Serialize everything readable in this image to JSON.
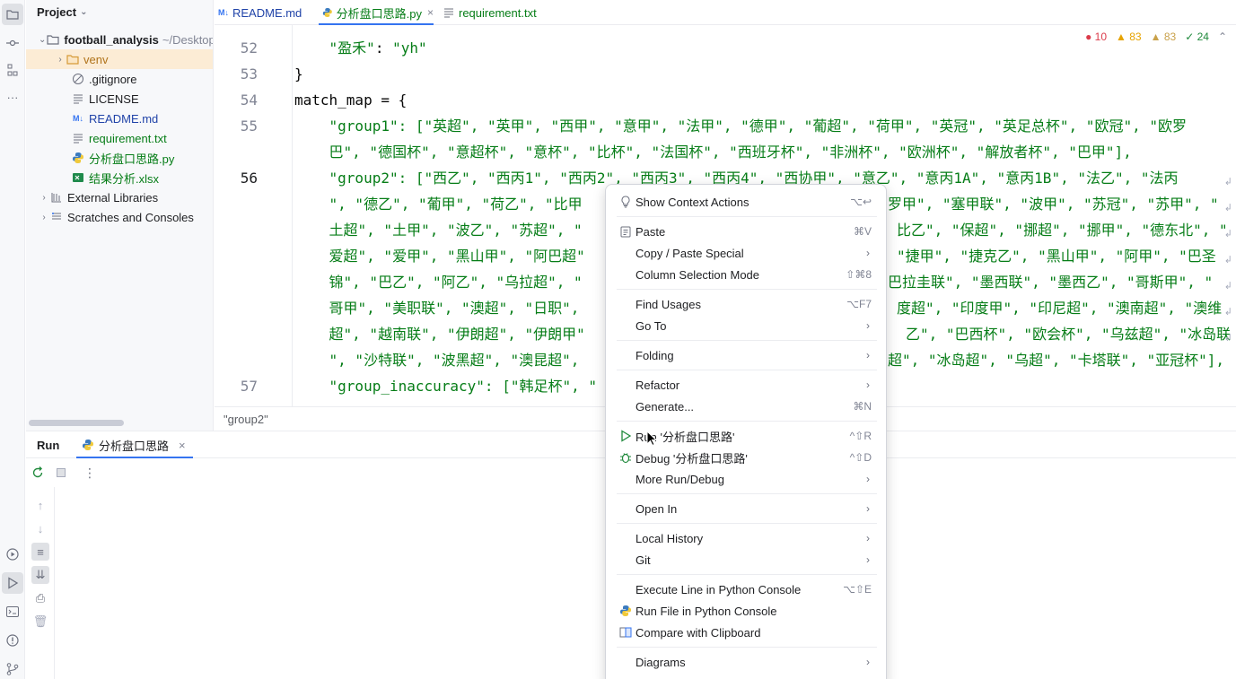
{
  "project": {
    "title": "Project",
    "tree": [
      {
        "label": "football_analysis",
        "suffix": "~/Desktop",
        "kind": "folder"
      },
      {
        "label": "venv",
        "kind": "folder"
      },
      {
        "label": ".gitignore",
        "kind": "ignore"
      },
      {
        "label": "LICENSE",
        "kind": "text"
      },
      {
        "label": "README.md",
        "kind": "md"
      },
      {
        "label": "requirement.txt",
        "kind": "txt"
      },
      {
        "label": "分析盘口思路.py",
        "kind": "py"
      },
      {
        "label": "结果分析.xlsx",
        "kind": "xlsx"
      },
      {
        "label": "External Libraries",
        "kind": "lib"
      },
      {
        "label": "Scratches and Consoles",
        "kind": "scratch"
      }
    ]
  },
  "editor": {
    "tabs": [
      {
        "label": "README.md",
        "icon": "markdown-icon"
      },
      {
        "label": "分析盘口思路.py",
        "icon": "python-icon"
      },
      {
        "label": "requirement.txt",
        "icon": "text-file-icon"
      }
    ],
    "inspections": {
      "errors": "10",
      "warnings": "83",
      "weak_warnings": "83",
      "typos": "24"
    },
    "line_numbers": [
      "52",
      "53",
      "54",
      "55",
      "56",
      "57"
    ],
    "lines": [
      {
        "prefix": "    ",
        "key": "\"盈禾\"",
        "rest": ": ",
        "value": "\"yh\""
      },
      {
        "text": "}"
      },
      {
        "text": "match_map = {"
      },
      {
        "indent": "    ",
        "key": "\"group1\"",
        "rest": ": [\"英超\", \"英甲\", \"西甲\", \"意甲\", \"法甲\", \"德甲\", \"葡超\", \"荷甲\", \"英冠\", \"英足总杯\", \"欧冠\", \"欧罗"
      },
      {
        "text": "    巴\", \"德国杯\", \"意超杯\", \"意杯\", \"比杯\", \"法国杯\", \"西班牙杯\", \"非洲杯\", \"欧洲杯\", \"解放者杯\", \"巴甲\"],"
      },
      {
        "indent": "    ",
        "key": "\"group2\"",
        "rest": ": [\"西乙\", \"西丙1\", \"西丙2\", \"西丙3\", \"西丙4\", \"西协甲\", \"意乙\", \"意丙1A\", \"意丙1B\", \"法乙\", \"法丙"
      },
      {
        "text": "    \", \"德乙\", \"葡甲\", \"荷乙\", \"比甲"
      },
      {
        "text": "    土超\", \"土甲\", \"波乙\", \"苏超\", \""
      },
      {
        "text": "    爱超\", \"爱甲\", \"黑山甲\", \"阿巴超\""
      },
      {
        "text": "    锦\", \"巴乙\", \"阿乙\", \"乌拉超\", \""
      },
      {
        "text": "    哥甲\", \"美职联\", \"澳超\", \"日职\","
      },
      {
        "text": "    超\", \"越南联\", \"伊朗超\", \"伊朗甲\""
      },
      {
        "text": "    \", \"沙特联\", \"波黑超\", \"澳昆超\","
      },
      {
        "indent": "    ",
        "key": "\"group_inaccuracy\"",
        "rest": ": [\"韩足杯\", \""
      }
    ],
    "right_fragments": [
      "罗甲\", \"塞甲联\", \"波甲\", \"苏冠\", \"苏甲\", \"",
      "比乙\", \"保超\", \"挪超\", \"挪甲\", \"德东北\", \"",
      "\"捷甲\", \"捷克乙\", \"黑山甲\", \"阿甲\", \"巴圣",
      "巴拉圭联\", \"墨西联\", \"墨西乙\", \"哥斯甲\", \"",
      "度超\", \"印度甲\", \"印尼超\", \"澳南超\", \"澳维",
      "乙\", \"巴西杯\", \"欧会杯\", \"乌兹超\", \"冰岛联",
      "超\", \"冰岛超\", \"乌超\", \"卡塔联\", \"亚冠杯\"],"
    ],
    "breadcrumb": "\"group2\""
  },
  "run": {
    "title": "Run",
    "tab_label": "分析盘口思路"
  },
  "context_menu": {
    "items": [
      {
        "label": "Show Context Actions",
        "shortcut": "⌥↩",
        "icon": "bulb"
      },
      {
        "label": "Paste",
        "shortcut": "⌘V",
        "icon": "paste"
      },
      {
        "label": "Copy / Paste Special",
        "submenu": true
      },
      {
        "label": "Column Selection Mode",
        "shortcut": "⇧⌘8"
      },
      {
        "label": "Find Usages",
        "shortcut": "⌥F7"
      },
      {
        "label": "Go To",
        "submenu": true
      },
      {
        "label": "Folding",
        "submenu": true
      },
      {
        "label": "Refactor",
        "submenu": true
      },
      {
        "label": "Generate...",
        "shortcut": "⌘N"
      },
      {
        "label": "Run '分析盘口思路'",
        "shortcut": "^⇧R",
        "icon": "run"
      },
      {
        "label": "Debug '分析盘口思路'",
        "shortcut": "^⇧D",
        "icon": "debug"
      },
      {
        "label": "More Run/Debug",
        "submenu": true
      },
      {
        "label": "Open In",
        "submenu": true
      },
      {
        "label": "Local History",
        "submenu": true
      },
      {
        "label": "Git",
        "submenu": true
      },
      {
        "label": "Execute Line in Python Console",
        "shortcut": "⌥⇧E"
      },
      {
        "label": "Run File in Python Console",
        "icon": "python"
      },
      {
        "label": "Compare with Clipboard",
        "icon": "compare"
      },
      {
        "label": "Diagrams",
        "submenu": true
      }
    ]
  }
}
